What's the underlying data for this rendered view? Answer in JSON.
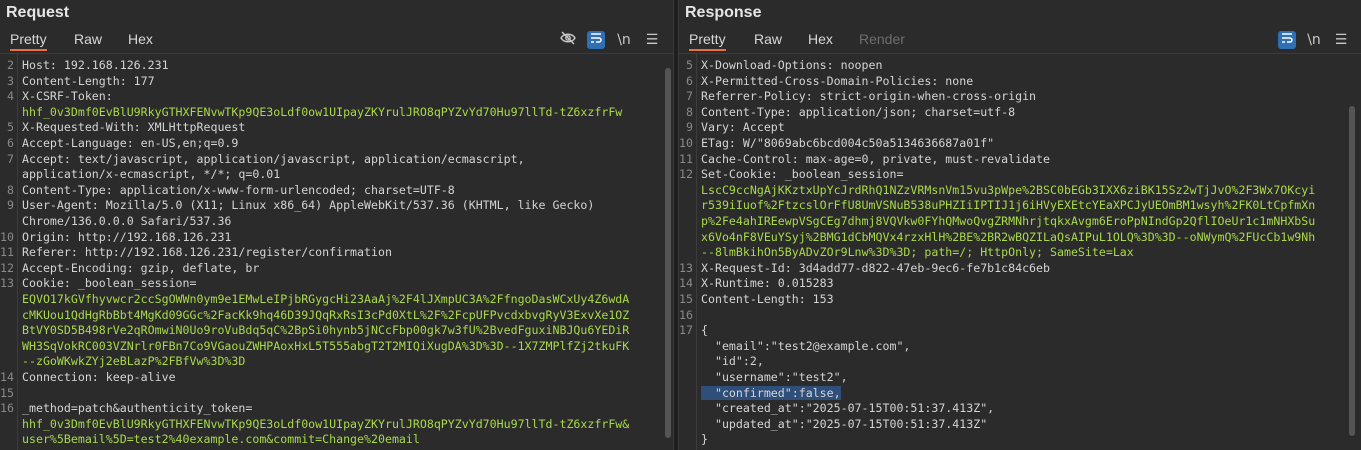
{
  "request": {
    "title": "Request",
    "tabs": [
      "Pretty",
      "Raw",
      "Hex"
    ],
    "icons": [
      "eye-off-icon",
      "wrap-icon",
      "newline-icon",
      "menu-icon"
    ],
    "newline_label": "\\n",
    "lines": [
      {
        "n": "2",
        "text": "Host: 192.168.126.231"
      },
      {
        "n": "3",
        "text": "Content-Length: 177"
      },
      {
        "n": "4",
        "text": "X-CSRF-Token:"
      },
      {
        "n": "",
        "text": "hhf_0v3Dmf0EvBlU9RkyGTHXFENvwTKp9QE3oLdf0ow1UIpayZKYrulJRO8qPYZvYd70Hu97llTd-tZ6xzfrFw",
        "cls": "g"
      },
      {
        "n": "5",
        "text": "X-Requested-With: XMLHttpRequest"
      },
      {
        "n": "6",
        "text": "Accept-Language: en-US,en;q=0.9"
      },
      {
        "n": "7",
        "text": "Accept: text/javascript, application/javascript, application/ecmascript,"
      },
      {
        "n": "",
        "text": "application/x-ecmascript, */*; q=0.01"
      },
      {
        "n": "8",
        "text": "Content-Type: application/x-www-form-urlencoded; charset=UTF-8"
      },
      {
        "n": "9",
        "text": "User-Agent: Mozilla/5.0 (X11; Linux x86_64) AppleWebKit/537.36 (KHTML, like Gecko)"
      },
      {
        "n": "",
        "text": "Chrome/136.0.0.0 Safari/537.36"
      },
      {
        "n": "10",
        "text": "Origin: http://192.168.126.231"
      },
      {
        "n": "11",
        "text": "Referer: http://192.168.126.231/register/confirmation"
      },
      {
        "n": "12",
        "text": "Accept-Encoding: gzip, deflate, br"
      },
      {
        "n": "13",
        "text": "Cookie: _boolean_session="
      },
      {
        "n": "",
        "text": "EQVO17kGVfhyvwcr2ccSgOWWn0ym9e1EMwLeIPjbRGygcHi23AaAj%2F4lJXmpUC3A%2FfngoDasWCxUy4Z6wdA",
        "cls": "g"
      },
      {
        "n": "",
        "text": "cMKUou1QdHgRbBbt4MgKd09GGc%2FacKk9hq46D39JQqRxRsI3cPd0XtL%2F%2FcpUFPvcdxbvgRyV3ExvXe1OZ",
        "cls": "g"
      },
      {
        "n": "",
        "text": "BtVY0SD5B498rVe2qROmwiN0Uo9roVuBdq5qC%2BpSi0hynb5jNCcFbp00gk7w3fU%2BvedFguxiNBJQu6YEDiR",
        "cls": "g"
      },
      {
        "n": "",
        "text": "WH3SqVokRC003VZNrlr0FBn7Co9VGaouZWHPAoxHxL5T555abgT2T2MIQiXugDA%3D%3D--1X7ZMPlfZj2tkuFK",
        "cls": "g"
      },
      {
        "n": "",
        "text": "--zGoWKwkZYj2eBLazP%2FBfVw%3D%3D",
        "cls": "g"
      },
      {
        "n": "14",
        "text": "Connection: keep-alive"
      },
      {
        "n": "15",
        "text": ""
      },
      {
        "n": "16",
        "text": "_method=patch&authenticity_token="
      },
      {
        "n": "",
        "text": "hhf_0v3Dmf0EvBlU9RkyGTHXFENvwTKp9QE3oLdf0ow1UIpayZKYrulJRO8qPYZvYd70Hu97llTd-tZ6xzfrFw&",
        "cls": "g"
      },
      {
        "n": "",
        "text": "user%5Bemail%5D=test2%40example.com&commit=Change%20email",
        "cls": "g"
      }
    ]
  },
  "response": {
    "title": "Response",
    "tabs": [
      "Pretty",
      "Raw",
      "Hex",
      "Render"
    ],
    "icons": [
      "wrap-icon",
      "newline-icon",
      "menu-icon"
    ],
    "newline_label": "\\n",
    "lines": [
      {
        "n": "5",
        "text": "X-Download-Options: noopen"
      },
      {
        "n": "6",
        "text": "X-Permitted-Cross-Domain-Policies: none"
      },
      {
        "n": "7",
        "text": "Referrer-Policy: strict-origin-when-cross-origin"
      },
      {
        "n": "8",
        "text": "Content-Type: application/json; charset=utf-8"
      },
      {
        "n": "9",
        "text": "Vary: Accept"
      },
      {
        "n": "10",
        "text": "ETag: W/\"8069abc6bcd004c50a5134636687a01f\""
      },
      {
        "n": "11",
        "text": "Cache-Control: max-age=0, private, must-revalidate"
      },
      {
        "n": "12",
        "text": "Set-Cookie: _boolean_session="
      },
      {
        "n": "",
        "text": "LscC9ccNgAjKKztxUpYcJrdRhQ1NZzVRMsnVm15vu3pWpe%2BSC0bEGb3IXX6ziBK15Sz2wTjJvO%2F3Wx7OKcyi",
        "cls": "g"
      },
      {
        "n": "",
        "text": "r539iIuof%2FtzcslOrFfU8UmVSNuB538uPHZIiIPTIJ1j6iHVyEXEtcYEaXPCJyUEOmBM1wsyh%2FK0LtCpfmXn",
        "cls": "g"
      },
      {
        "n": "",
        "text": "p%2Fe4ahIREewpVSgCEg7dhmj8VQVkw0FYhQMwoQvgZRMNhrjtqkxAvgm6EroPpNIndGp2QflIOeUr1c1mNHXbSu",
        "cls": "g"
      },
      {
        "n": "",
        "text": "x6Vo4nF8VEuYSyj%2BMG1dCbMQVx4rzxHlH%2BE%2BR2wBQZILaQsAIPuL1OLQ%3D%3D--oNWymQ%2FUcCb1w9Nh",
        "cls": "g"
      },
      {
        "n": "",
        "text": "--8lmBkihOn5ByADvZOr9Lnw%3D%3D; path=/; HttpOnly; SameSite=Lax",
        "cls": "g"
      },
      {
        "n": "13",
        "text": "X-Request-Id: 3d4add77-d822-47eb-9ec6-fe7b1c84c6eb"
      },
      {
        "n": "14",
        "text": "X-Runtime: 0.015283"
      },
      {
        "n": "15",
        "text": "Content-Length: 153"
      },
      {
        "n": "16",
        "text": ""
      },
      {
        "n": "17",
        "text": "{"
      },
      {
        "n": "",
        "text": "  \"email\":\"test2@example.com\","
      },
      {
        "n": "",
        "text": "  \"id\":2,"
      },
      {
        "n": "",
        "text": "  \"username\":\"test2\","
      },
      {
        "n": "",
        "text": "  \"confirmed\":false,",
        "cls": "hl"
      },
      {
        "n": "",
        "text": "  \"created_at\":\"2025-07-15T00:51:37.413Z\","
      },
      {
        "n": "",
        "text": "  \"updated_at\":\"2025-07-15T00:51:37.413Z\""
      },
      {
        "n": "",
        "text": "}"
      }
    ]
  }
}
